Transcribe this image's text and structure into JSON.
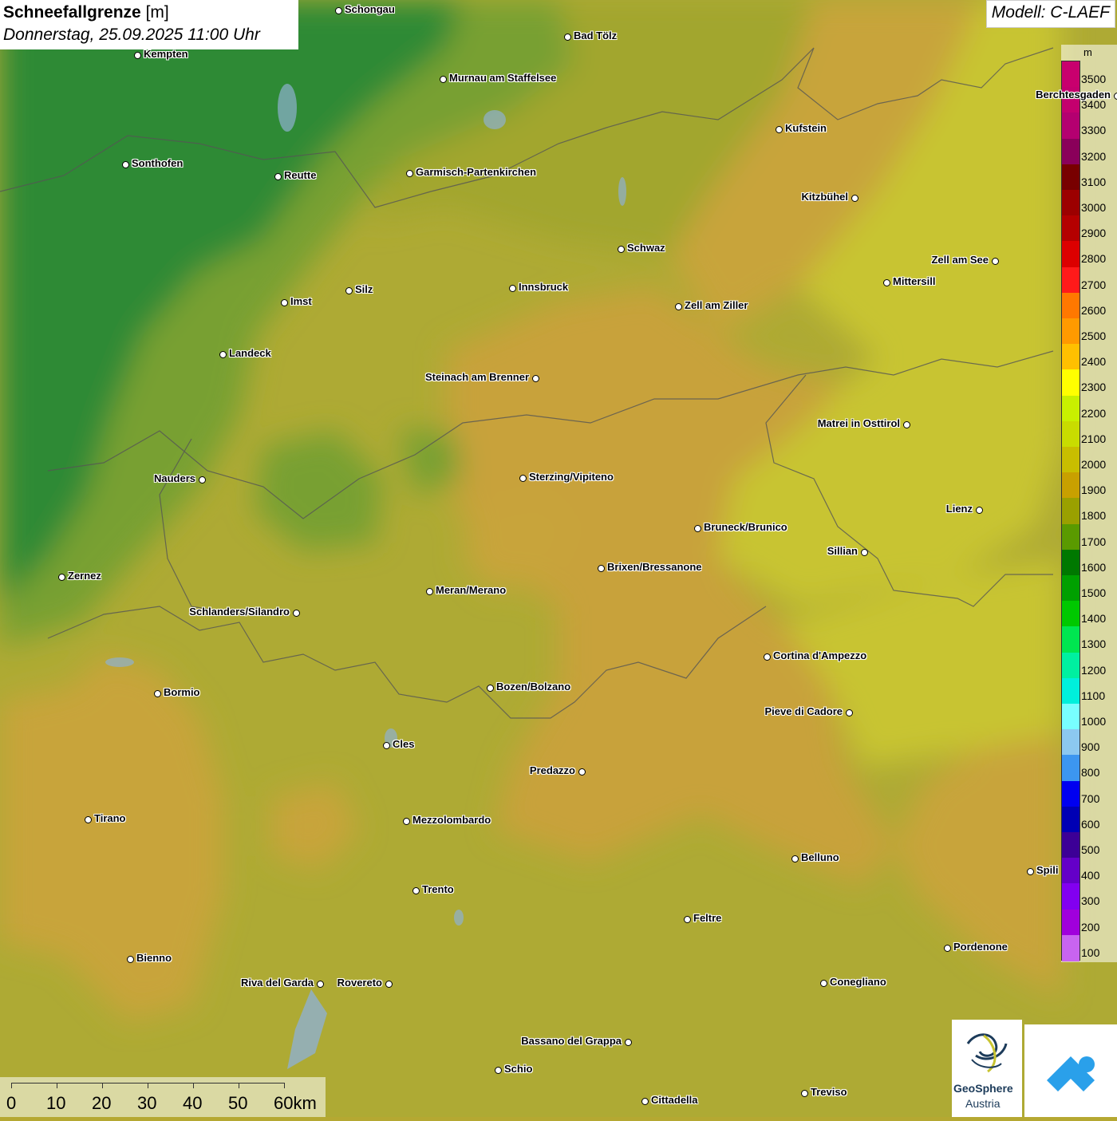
{
  "header": {
    "title_bold": "Schneefallgrenze",
    "title_unit": "[m]",
    "date": "Donnerstag, 25.09.2025 11:00 Uhr",
    "model": "Modell: C-LAEF"
  },
  "legend": {
    "unit": "m",
    "levels": [
      {
        "label": "3500",
        "color": "#c8006e"
      },
      {
        "label": "3400",
        "color": "#c4006e"
      },
      {
        "label": "3300",
        "color": "#b40070"
      },
      {
        "label": "3200",
        "color": "#8a005a"
      },
      {
        "label": "3100",
        "color": "#780000"
      },
      {
        "label": "3000",
        "color": "#9c0000"
      },
      {
        "label": "2900",
        "color": "#b40000"
      },
      {
        "label": "2800",
        "color": "#dc0000"
      },
      {
        "label": "2700",
        "color": "#ff1a1a"
      },
      {
        "label": "2600",
        "color": "#ff7800"
      },
      {
        "label": "2500",
        "color": "#ff9a00"
      },
      {
        "label": "2400",
        "color": "#ffc000"
      },
      {
        "label": "2300",
        "color": "#ffff00"
      },
      {
        "label": "2200",
        "color": "#c8f000"
      },
      {
        "label": "2100",
        "color": "#c8dc00"
      },
      {
        "label": "2000",
        "color": "#c8be00"
      },
      {
        "label": "1900",
        "color": "#c8a000"
      },
      {
        "label": "1800",
        "color": "#9aa000"
      },
      {
        "label": "1700",
        "color": "#5a9a00"
      },
      {
        "label": "1600",
        "color": "#007800"
      },
      {
        "label": "1500",
        "color": "#00a000"
      },
      {
        "label": "1400",
        "color": "#00c800"
      },
      {
        "label": "1300",
        "color": "#00e650"
      },
      {
        "label": "1200",
        "color": "#00f0a0"
      },
      {
        "label": "1100",
        "color": "#00f0dc"
      },
      {
        "label": "1000",
        "color": "#78ffff"
      },
      {
        "label": "900",
        "color": "#8cc8f0"
      },
      {
        "label": "800",
        "color": "#3c96f0"
      },
      {
        "label": "700",
        "color": "#0000f0"
      },
      {
        "label": "600",
        "color": "#0000b4"
      },
      {
        "label": "500",
        "color": "#3c0096"
      },
      {
        "label": "400",
        "color": "#6400c8"
      },
      {
        "label": "300",
        "color": "#8200f0"
      },
      {
        "label": "200",
        "color": "#a000dc"
      },
      {
        "label": "100",
        "color": "#c864f0"
      }
    ]
  },
  "cities": [
    {
      "name": "Schongau"
    },
    {
      "name": "Bad Tölz"
    },
    {
      "name": "Kempten"
    },
    {
      "name": "Murnau am Staffelsee"
    },
    {
      "name": "Berchtesgaden"
    },
    {
      "name": "Kufstein"
    },
    {
      "name": "Sonthofen"
    },
    {
      "name": "Reutte"
    },
    {
      "name": "Garmisch-Partenkirchen"
    },
    {
      "name": "Kitzbühel"
    },
    {
      "name": "Schwaz"
    },
    {
      "name": "Zell am See"
    },
    {
      "name": "Mittersill"
    },
    {
      "name": "Innsbruck"
    },
    {
      "name": "Imst"
    },
    {
      "name": "Silz"
    },
    {
      "name": "Zell am Ziller"
    },
    {
      "name": "Landeck"
    },
    {
      "name": "Steinach am Brenner"
    },
    {
      "name": "Matrei in Osttirol"
    },
    {
      "name": "Nauders"
    },
    {
      "name": "Sterzing/Vipiteno"
    },
    {
      "name": "Lienz"
    },
    {
      "name": "Bruneck/Brunico"
    },
    {
      "name": "Sillian"
    },
    {
      "name": "Zernez"
    },
    {
      "name": "Brixen/Bressanone"
    },
    {
      "name": "Meran/Merano"
    },
    {
      "name": "Schlanders/Silandro"
    },
    {
      "name": "Cortina d'Ampezzo"
    },
    {
      "name": "Bormio"
    },
    {
      "name": "Bozen/Bolzano"
    },
    {
      "name": "Pieve di Cadore"
    },
    {
      "name": "Cles"
    },
    {
      "name": "Predazzo"
    },
    {
      "name": "Tirano"
    },
    {
      "name": "Mezzolombardo"
    },
    {
      "name": "Belluno"
    },
    {
      "name": "Spili"
    },
    {
      "name": "Trento"
    },
    {
      "name": "Feltre"
    },
    {
      "name": "Pordenone"
    },
    {
      "name": "Bienno"
    },
    {
      "name": "Riva del Garda"
    },
    {
      "name": "Rovereto"
    },
    {
      "name": "Conegliano"
    },
    {
      "name": "Bassano del Grappa"
    },
    {
      "name": "Schio"
    },
    {
      "name": "Treviso"
    },
    {
      "name": "Cittadella"
    }
  ],
  "scale": {
    "labels": [
      "0",
      "10",
      "20",
      "30",
      "40",
      "50",
      "60km"
    ]
  },
  "logo": {
    "line1": "GeoSphere",
    "line2": "Austria"
  },
  "colors": {
    "zone_low": "#2e8a2e",
    "zone_mid": "#9aa52c",
    "zone_high": "#c9a43a",
    "zone_yellow": "#c8c632"
  }
}
